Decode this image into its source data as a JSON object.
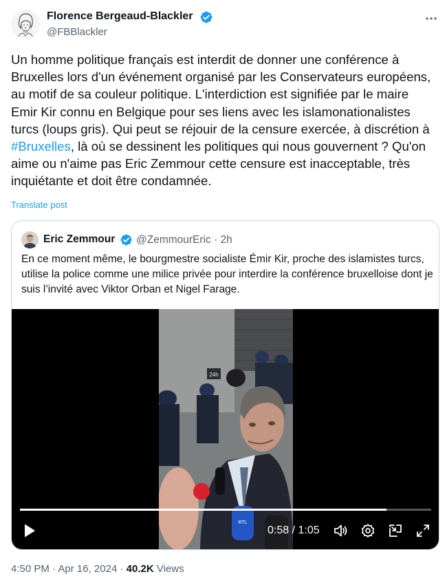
{
  "author": {
    "name": "Florence Bergeaud-Blackler",
    "handle": "@FBBlackler"
  },
  "post": {
    "text_before_hashtag": "Un homme politique français est interdit de donner une conférence à Bruxelles lors d'un événement organisé par les Conservateurs européens, au motif de sa couleur politique. L'interdiction est signifiée par le maire Emir Kir connu en Belgique pour ses liens avec les islamonationalistes turcs (loups gris). Qui peut se réjouir de la censure exercée, à discrétion à ",
    "hashtag": "#Bruxelles",
    "text_after_hashtag": ", là où se dessinent les politiques qui nous gouvernent ? Qu'on aime ou n'aime pas Eric Zemmour cette censure est inacceptable, très inquiétante et doit être condamnée.",
    "translate_label": "Translate post"
  },
  "quote": {
    "name": "Eric Zemmour",
    "handle": "@ZemmourEric",
    "separator": "·",
    "time": "2h",
    "text": "En ce moment même, le bourgmestre socialiste Émir Kir, proche des islamistes turcs, utilise la police comme une milice privée pour interdire la conférence bruxelloise dont je suis l’invité avec Viktor Orban et Nigel Farage.",
    "video": {
      "current_time": "0:58",
      "time_separator": "/",
      "duration": "1:05",
      "progress": 0.892,
      "frame_sign": "24h"
    }
  },
  "footer": {
    "time": "4:50 PM",
    "separator": "·",
    "date": "Apr 16, 2024",
    "dot": "·",
    "views_count": "40.2K",
    "views_label": "Views"
  },
  "colors": {
    "accent": "#1d9bf0",
    "text": "#0f1419",
    "secondary": "#536471",
    "border": "#cfd9de"
  },
  "icons": [
    "verified-badge-icon",
    "more-icon",
    "play-icon",
    "volume-icon",
    "settings-icon",
    "pip-icon",
    "fullscreen-icon"
  ]
}
